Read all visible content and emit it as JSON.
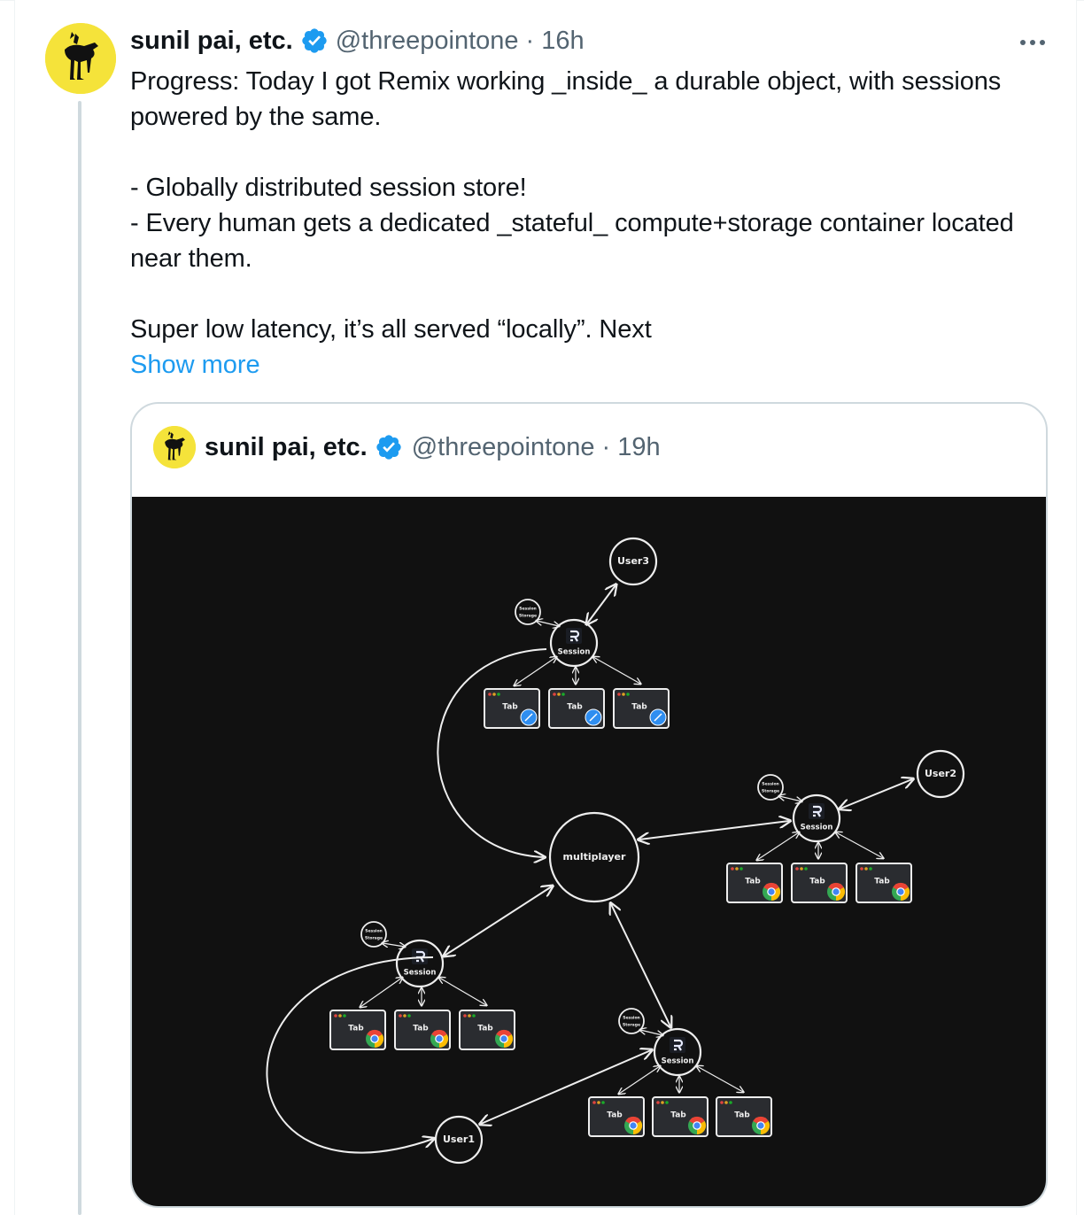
{
  "tweet": {
    "author": {
      "display_name": "sunil pai, etc.",
      "handle": "@threepointone",
      "verified": true,
      "avatar_icon": "dog-illustration-avatar"
    },
    "separator": "·",
    "time": "16h",
    "more_icon": "more-horizontal-icon",
    "text": "Progress: Today I got Remix working _inside_ a durable object, with sessions powered by the same.\n\n- Globally distributed session store!\n- Every human gets a dedicated _stateful_ compute+storage container located near them.\n\nSuper low latency, it’s all served “locally”. Next",
    "show_more_label": "Show more"
  },
  "quoted_tweet": {
    "author": {
      "display_name": "sunil pai, etc.",
      "handle": "@threepointone",
      "verified": true
    },
    "separator": "·",
    "time": "19h",
    "diagram": {
      "center_label": "multiplayer",
      "clusters": [
        {
          "id": "top",
          "session_label": "Session",
          "storage_label": [
            "Session",
            "Storage"
          ],
          "user_label": "User3",
          "tabs": [
            "Tab",
            "Tab",
            "Tab"
          ],
          "browser": "safari"
        },
        {
          "id": "right",
          "session_label": "Session",
          "storage_label": [
            "Session",
            "Storage"
          ],
          "user_label": "User2",
          "tabs": [
            "Tab",
            "Tab",
            "Tab"
          ],
          "browser": "chrome"
        },
        {
          "id": "left",
          "session_label": "Session",
          "storage_label": [
            "Session",
            "Storage"
          ],
          "tabs": [
            "Tab",
            "Tab",
            "Tab"
          ],
          "browser": "chrome"
        },
        {
          "id": "bottom",
          "session_label": "Session",
          "storage_label": [
            "Session",
            "Storage"
          ],
          "tabs": [
            "Tab",
            "Tab",
            "Tab"
          ],
          "browser": "chrome"
        }
      ],
      "user1_label": "User1"
    }
  },
  "colors": {
    "accent": "#1d9bf0",
    "secondary_text": "#536471",
    "primary_text": "#0f1419",
    "border": "#cfd9de",
    "diagram_bg": "#111111",
    "avatar_bg": "#f5e33a"
  }
}
